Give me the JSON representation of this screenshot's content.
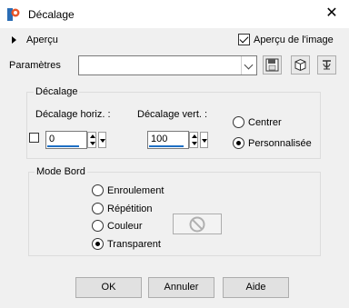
{
  "window": {
    "title": "Décalage",
    "close_icon": "close-icon",
    "app_icon": "paintshop-icon"
  },
  "preview": {
    "label": "Aperçu",
    "image_label": "Aperçu de l'image",
    "image_checked": true
  },
  "params": {
    "label": "Paramètres",
    "value": "",
    "buttons": [
      "save-icon",
      "delete-icon",
      "reset-icon"
    ]
  },
  "offset": {
    "group": "Décalage",
    "h_label": "Décalage horiz. :",
    "v_label": "Décalage vert. :",
    "h_value": "0",
    "v_value": "100",
    "options": [
      {
        "label": "Centrer",
        "selected": false
      },
      {
        "label": "Personnalisée",
        "selected": true
      }
    ]
  },
  "edge": {
    "group": "Mode Bord",
    "options": [
      {
        "label": "Enroulement",
        "selected": false
      },
      {
        "label": "Répétition",
        "selected": false
      },
      {
        "label": "Couleur",
        "selected": false
      },
      {
        "label": "Transparent",
        "selected": true
      }
    ]
  },
  "actions": {
    "ok": "OK",
    "cancel": "Annuler",
    "help": "Aide"
  }
}
